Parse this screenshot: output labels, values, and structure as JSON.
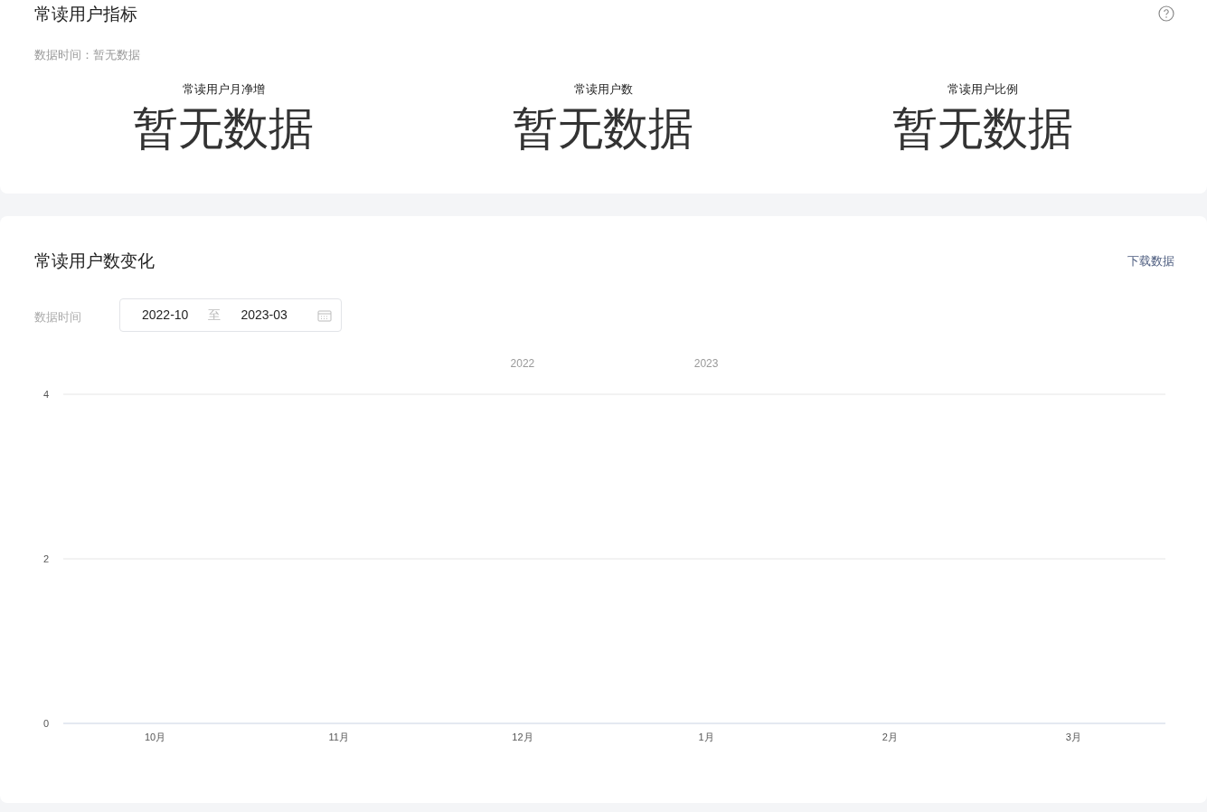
{
  "metrics_card": {
    "title": "常读用户指标",
    "data_time": "数据时间：暂无数据",
    "metrics": [
      {
        "label": "常读用户月净增",
        "value": "暂无数据"
      },
      {
        "label": "常读用户数",
        "value": "暂无数据"
      },
      {
        "label": "常读用户比例",
        "value": "暂无数据"
      }
    ]
  },
  "trend_card": {
    "title": "常读用户数变化",
    "download_link": "下载数据",
    "date_label": "数据时间",
    "date_range": {
      "start": "2022-10",
      "separator": "至",
      "end": "2023-03"
    },
    "chart_data": {
      "type": "line",
      "categories": [
        "10月",
        "11月",
        "12月",
        "1月",
        "2月",
        "3月"
      ],
      "ylim": [
        0,
        4
      ],
      "yticks": [
        0,
        2,
        4
      ],
      "annotations": [
        "2022",
        "2023"
      ]
    }
  }
}
